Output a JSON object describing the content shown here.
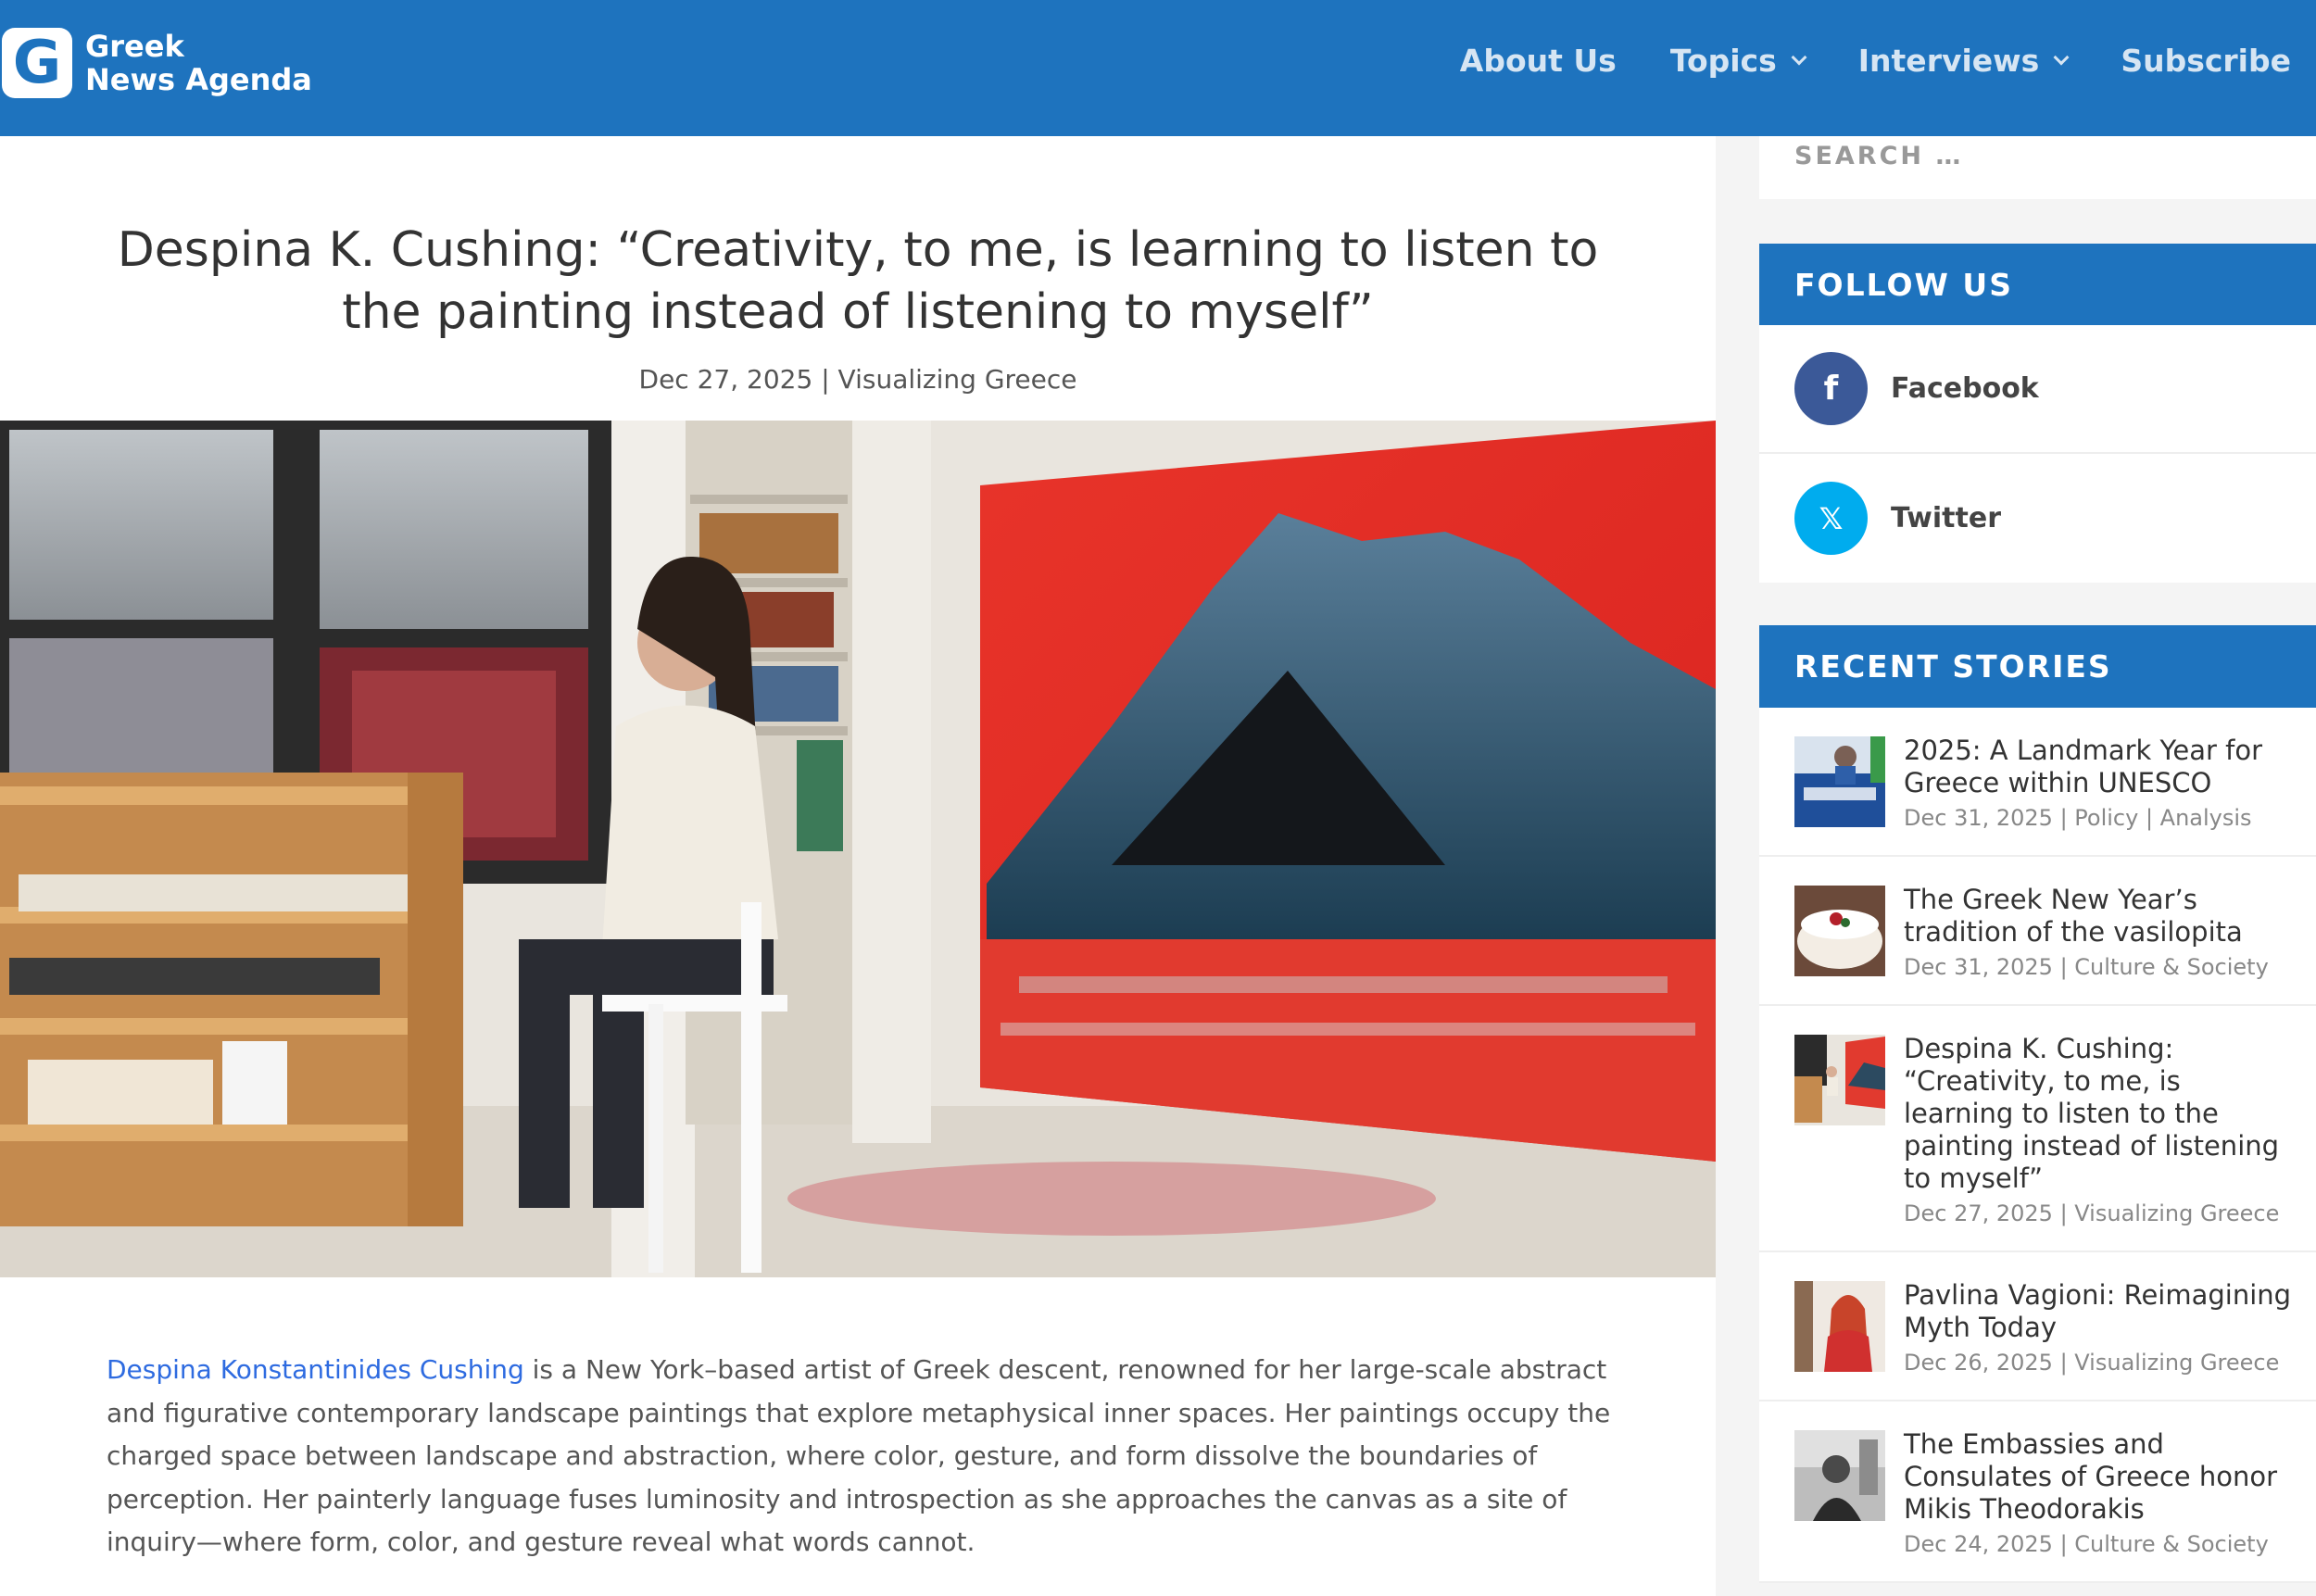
{
  "header": {
    "logo_letter": "G",
    "logo_line1": "Greek",
    "logo_line2": "News Agenda",
    "nav": [
      {
        "label": "About Us"
      },
      {
        "label": "Topics"
      },
      {
        "label": "Interviews"
      },
      {
        "label": "Subscribe"
      }
    ],
    "color": "#1e73be"
  },
  "article": {
    "title": "Despina K. Cushing: “Creativity, to me, is learning to listen to the painting instead of listening to myself”",
    "date": "Dec 27, 2025",
    "separator": "|",
    "category": "Visualizing Greece",
    "body_link": "Despina Konstantinides Cushing",
    "body_text": " is a New York–based artist of Greek descent, renowned for her large-scale abstract and figurative contemporary landscape paintings that explore metaphysical inner spaces. Her paintings occupy the charged space between landscape and abstraction, where color, gesture, and form dissolve the boundaries of perception. Her painterly language fuses luminosity and introspection as she approaches the canvas as a site of inquiry—where form, color, and gesture reveal what words cannot."
  },
  "sidebar": {
    "search_placeholder": "SEARCH …",
    "follow_title": "FOLLOW US",
    "follow": [
      {
        "label": "Facebook",
        "glyph": "f",
        "color": "#3b5998"
      },
      {
        "label": "Twitter",
        "glyph": "𝕏",
        "color": "#00acee"
      }
    ],
    "recent_title": "RECENT STORIES",
    "stories": [
      {
        "title": "2025: A Landmark Year for Greece within UNESCO",
        "meta": "Dec 31, 2025 | Policy | Analysis"
      },
      {
        "title": "The Greek New Year’s tradition of the vasilopita",
        "meta": "Dec 31, 2025 | Culture & Society"
      },
      {
        "title": "Despina K. Cushing: “Creativity, to me, is learning to listen to the painting instead of listening to myself”",
        "meta": "Dec 27, 2025 | Visualizing Greece"
      },
      {
        "title": "Pavlina Vagioni: Reimagining Myth Today",
        "meta": "Dec 26, 2025 | Visualizing Greece"
      },
      {
        "title": "The Embassies and Consulates of Greece honor Mikis Theodorakis",
        "meta": "Dec 24, 2025 | Culture & Society"
      }
    ]
  }
}
